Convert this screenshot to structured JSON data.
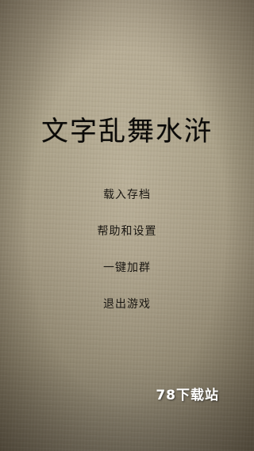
{
  "game": {
    "title": "文字乱舞水浒"
  },
  "menu": {
    "items": [
      {
        "label": "载入存档"
      },
      {
        "label": "帮助和设置"
      },
      {
        "label": "一键加群"
      },
      {
        "label": "退出游戏"
      }
    ]
  },
  "watermark": {
    "text": "78下载站"
  },
  "colors": {
    "title_text": "#0b0a08",
    "menu_text": "#1a1712",
    "watermark_text": "#ffffff",
    "background_paper": "#a9a087"
  }
}
